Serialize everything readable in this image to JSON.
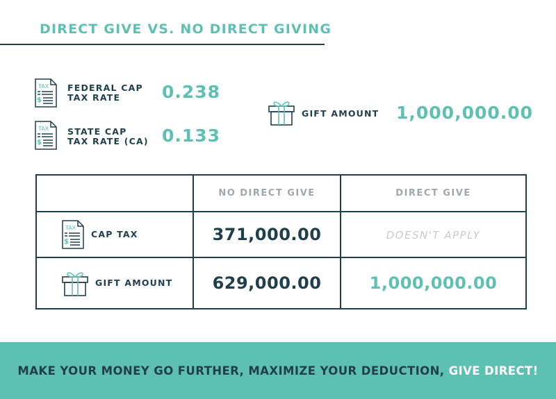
{
  "title": "DIRECT GIVE VS. NO DIRECT GIVING",
  "rates": {
    "federal": {
      "label_line1": "FEDERAL CAP",
      "label_line2": "TAX RATE",
      "value": "0.238"
    },
    "state": {
      "label_line1": "STATE CAP",
      "label_line2": "TAX RATE (CA)",
      "value": "0.133"
    }
  },
  "gift": {
    "label": "GIFT AMOUNT",
    "value": "1,000,000.00"
  },
  "icons": {
    "tax": "tax-document-icon",
    "gift": "gift-box-icon",
    "tax_text": "TAX"
  },
  "table": {
    "headers": [
      "",
      "NO DIRECT GIVE",
      "DIRECT GIVE"
    ],
    "rows": [
      {
        "label": "CAP TAX",
        "no_direct": "371,000.00",
        "direct": "DOESN'T APPLY"
      },
      {
        "label": "GIFT AMOUNT",
        "no_direct": "629,000.00",
        "direct": "1,000,000.00"
      }
    ]
  },
  "footer": {
    "text": "MAKE YOUR MONEY GO FURTHER, MAXIMIZE YOUR DEDUCTION, ",
    "accent": "GIVE DIRECT!"
  },
  "colors": {
    "teal": "#5ec0b3",
    "navy": "#1f3f4d",
    "gray": "#a4a7a9",
    "light_gray": "#c9cbcc"
  }
}
